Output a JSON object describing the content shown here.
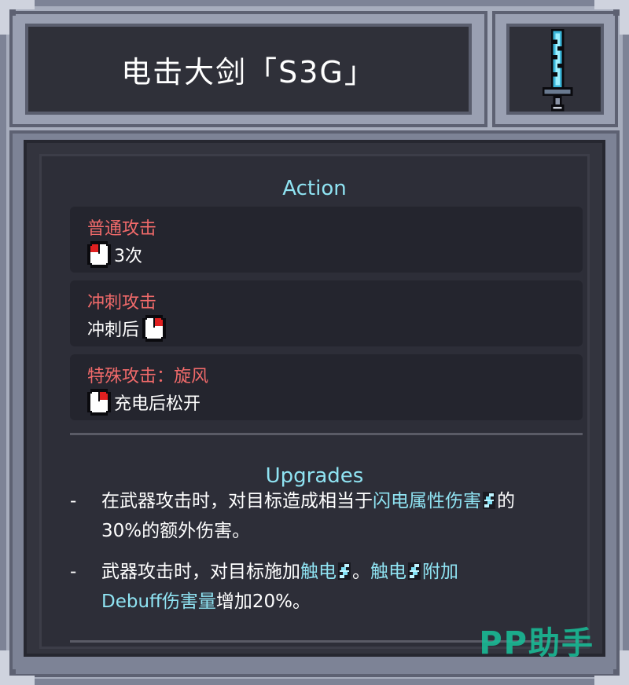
{
  "weapon": {
    "title": "电击大剑「S3G」",
    "icon": "lightning-greatsword-icon"
  },
  "action": {
    "heading": "Action",
    "cards": [
      {
        "title": "普通攻击",
        "icon": "left-mouse-icon",
        "text": "3次",
        "icon_position": "before"
      },
      {
        "title": "冲刺攻击",
        "icon": "right-mouse-icon",
        "text": "冲刺后",
        "icon_position": "after"
      },
      {
        "title": "特殊攻击：旋风",
        "icon": "right-mouse-icon",
        "text": "充电后松开",
        "icon_position": "before"
      }
    ]
  },
  "upgrades": {
    "heading": "Upgrades",
    "items": [
      {
        "dash": "-",
        "parts": {
          "a": "在武器攻击时，对目标造成相当于",
          "b": "闪电属性伤害",
          "c": "的",
          "d": "30%的额外伤害。"
        }
      },
      {
        "dash": "-",
        "parts": {
          "a": "武器攻击时，对目标施加",
          "b": "触电",
          "c": "。",
          "d": "触电",
          "e": "附加",
          "f": "Debuff伤害量",
          "g": "增加20%。"
        }
      }
    ]
  },
  "watermark": "PP助手",
  "colors": {
    "accent": "#8fe3f2",
    "action_title": "#f06a6a",
    "panel": "#2d2e38",
    "frame": "#a7adbd",
    "watermark": "#18c19a"
  }
}
